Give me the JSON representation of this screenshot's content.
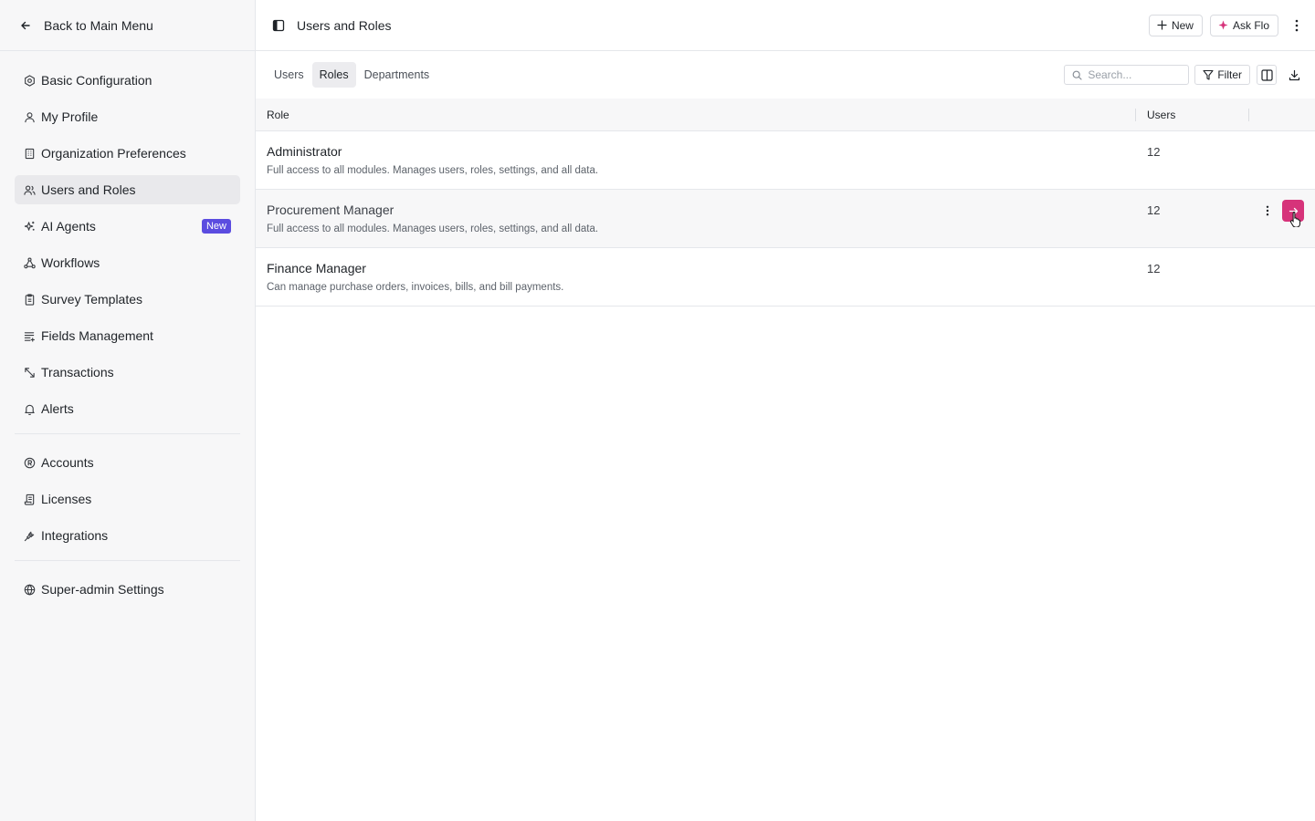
{
  "sidebar": {
    "back_label": "Back to Main Menu",
    "items": [
      {
        "label": "Basic Configuration",
        "icon": "settings-icon"
      },
      {
        "label": "My Profile",
        "icon": "user-icon"
      },
      {
        "label": "Organization Preferences",
        "icon": "building-icon"
      },
      {
        "label": "Users and Roles",
        "icon": "users-icon",
        "active": true
      },
      {
        "label": "AI Agents",
        "icon": "sparkles-icon",
        "badge": "New"
      },
      {
        "label": "Workflows",
        "icon": "workflow-icon"
      },
      {
        "label": "Survey Templates",
        "icon": "clipboard-icon"
      },
      {
        "label": "Fields Management",
        "icon": "list-plus-icon"
      },
      {
        "label": "Transactions",
        "icon": "arrows-icon"
      },
      {
        "label": "Alerts",
        "icon": "bell-icon"
      }
    ],
    "items2": [
      {
        "label": "Accounts",
        "icon": "registered-icon"
      },
      {
        "label": "Licenses",
        "icon": "scroll-icon"
      },
      {
        "label": "Integrations",
        "icon": "plug-icon"
      }
    ],
    "items3": [
      {
        "label": "Super-admin Settings",
        "icon": "shield-icon"
      }
    ]
  },
  "header": {
    "title": "Users and Roles",
    "new_label": "New",
    "ask_label": "Ask Flo"
  },
  "tabs": [
    {
      "label": "Users"
    },
    {
      "label": "Roles",
      "active": true
    },
    {
      "label": "Departments"
    }
  ],
  "toolbar": {
    "search_placeholder": "Search...",
    "filter_label": "Filter"
  },
  "table": {
    "columns": {
      "role": "Role",
      "users": "Users"
    },
    "rows": [
      {
        "name": "Administrator",
        "desc": "Full access to all modules. Manages users, roles, settings, and all data.",
        "users": "12"
      },
      {
        "name": "Procurement Manager",
        "desc": "Full access to all modules. Manages users, roles, settings, and all data.",
        "users": "12"
      },
      {
        "name": "Finance Manager",
        "desc": "Can manage purchase orders, invoices, bills, and bill payments.",
        "users": "12"
      }
    ]
  },
  "colors": {
    "accent": "#d6337a",
    "badge": "#5b4ce0",
    "sidebar_bg": "#f7f7f8"
  }
}
